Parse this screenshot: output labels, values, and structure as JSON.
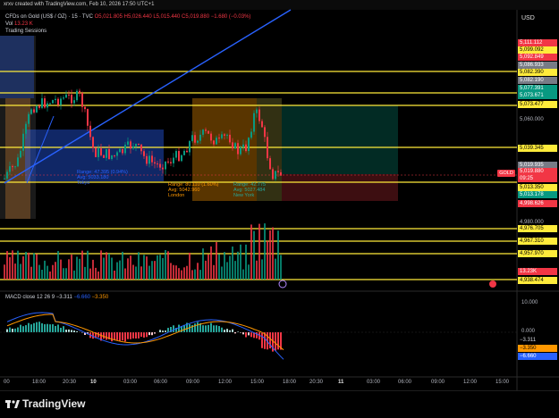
{
  "topbar": {
    "text": "xrxv created with TradingView.com, Feb 10, 2026 17:50 UTC+1"
  },
  "legend": {
    "symbol": "CFDs on Gold (US$ / OZ) · 15 · TVC",
    "open": "O5,021.805",
    "high": "H5,026.440",
    "low": "L5,015.440",
    "close": "C5,019.880",
    "change": "−1.680 (−0.03%)",
    "vol_label": "Vol",
    "vol_value": "13.23 K",
    "sessions": "Trading Sessions"
  },
  "currency": "USD",
  "price_tags": [
    {
      "text": "5,111.112",
      "bg": "#f23645",
      "fg": "#ffffff"
    },
    {
      "text": "5,099.092",
      "bg": "#ffeb3b",
      "fg": "#000000"
    },
    {
      "text": "5,092.849",
      "bg": "#f23645",
      "fg": "#ffffff"
    },
    {
      "text": "5,086.933",
      "bg": "#787b86",
      "fg": "#ffffff"
    },
    {
      "text": "5,082.390",
      "bg": "#ffeb3b",
      "fg": "#000000"
    },
    {
      "text": "5,082.190",
      "bg": "#787b86",
      "fg": "#ffffff"
    },
    {
      "text": "5,077.391",
      "bg": "#089981",
      "fg": "#ffffff"
    },
    {
      "text": "5,073.671",
      "bg": "#089981",
      "fg": "#ffffff"
    },
    {
      "text": "5,073.477",
      "bg": "#ffeb3b",
      "fg": "#000000"
    },
    {
      "text": "5,039.345",
      "bg": "#ffeb3b",
      "fg": "#000000"
    },
    {
      "text": "5,019.935",
      "bg": "#787b86",
      "fg": "#ffffff"
    },
    {
      "text": "5,019.880",
      "bg": "#f23645",
      "fg": "#ffffff"
    },
    {
      "text": "09:25",
      "bg": "#f23645",
      "fg": "#ffffff"
    },
    {
      "text": "5,013.350",
      "bg": "#ffeb3b",
      "fg": "#000000"
    },
    {
      "text": "5,013.178",
      "bg": "#089981",
      "fg": "#ffffff"
    },
    {
      "text": "4,998.626",
      "bg": "#f23645",
      "fg": "#ffffff"
    },
    {
      "text": "4,976.705",
      "bg": "#ffeb3b",
      "fg": "#000000"
    },
    {
      "text": "4,967.310",
      "bg": "#ffeb3b",
      "fg": "#000000"
    },
    {
      "text": "4,957.970",
      "bg": "#ffeb3b",
      "fg": "#000000"
    },
    {
      "text": "13.23K",
      "bg": "#f23645",
      "fg": "#ffffff"
    },
    {
      "text": "4,938.474",
      "bg": "#ffeb3b",
      "fg": "#000000"
    }
  ],
  "axis_prices": [
    "5,060.000",
    "4,980.000"
  ],
  "gold_badge": "GOLD",
  "macd": {
    "label": "MACD",
    "params": "close 12 26 9",
    "v1": "−3.311",
    "v2": "−6.660",
    "v3": "−3.350",
    "axis": [
      "10.000",
      "0.000"
    ],
    "tags": [
      {
        "text": "−3.311",
        "bg": "#000000",
        "fg": "#d1d4dc"
      },
      {
        "text": "−3.350",
        "bg": "#ff9800",
        "fg": "#000000"
      },
      {
        "text": "−6.660",
        "bg": "#2962ff",
        "fg": "#ffffff"
      }
    ]
  },
  "sessions": [
    {
      "lines": [
        "Range: 47.395 (0.94%)",
        "Avg: 5033.180",
        "Tokyo"
      ],
      "color": "#2962ff"
    },
    {
      "lines": [
        "Range: 80.110 (1.60%)",
        "Avg: 5042.960",
        "London"
      ],
      "color": "#ff9800"
    },
    {
      "lines": [
        "Range: 42.775",
        "Avg: 5027.484",
        "New York"
      ],
      "color": "#26a69a"
    }
  ],
  "time_labels": [
    "00",
    "18:00",
    "20:30",
    "10",
    "03:00",
    "06:00",
    "09:00",
    "12:00",
    "15:00",
    "18:00",
    "20:30",
    "11",
    "03:00",
    "06:00",
    "09:00",
    "12:00",
    "15:00"
  ],
  "footer": {
    "brand": "TradingView"
  },
  "colors": {
    "up": "#089981",
    "down": "#f23645",
    "trend": "#2962ff",
    "level": "#ffeb3b"
  }
}
